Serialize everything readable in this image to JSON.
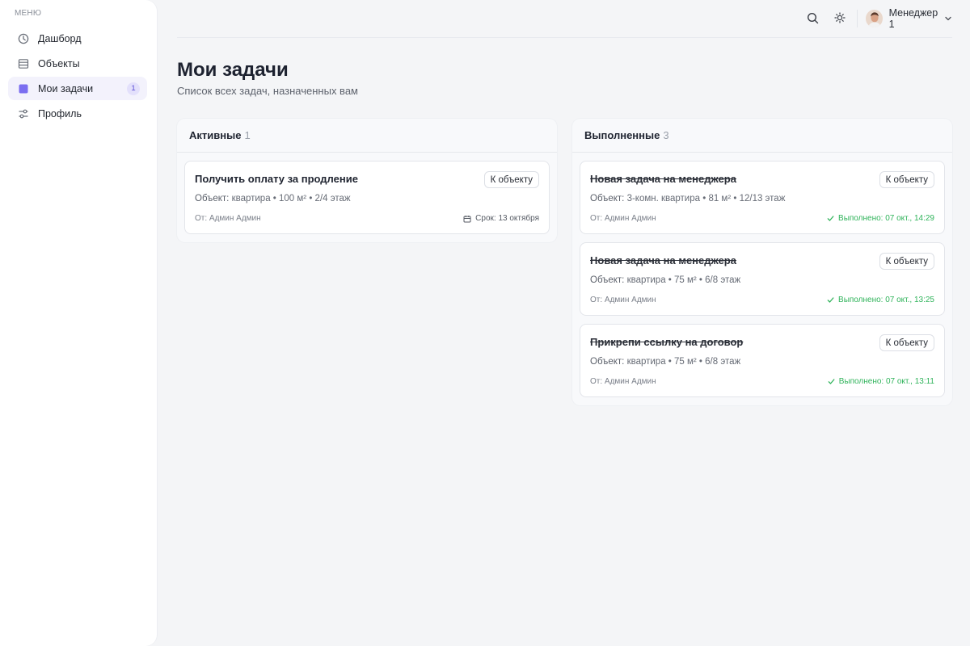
{
  "sidebar": {
    "caption": "МЕНЮ",
    "items": [
      {
        "label": "Дашборд",
        "icon": "dashboard-icon",
        "active": false
      },
      {
        "label": "Объекты",
        "icon": "list-icon",
        "active": false
      },
      {
        "label": "Мои задачи",
        "icon": "tasks-square-icon",
        "active": true,
        "badge": "1"
      },
      {
        "label": "Профиль",
        "icon": "sliders-icon",
        "active": false
      }
    ]
  },
  "topbar": {
    "user_name": "Менеджер 1"
  },
  "page": {
    "title": "Мои задачи",
    "subtitle": "Список всех задач, назначенных вам"
  },
  "columns": {
    "active": {
      "title": "Активные",
      "count": "1",
      "cards": [
        {
          "title": "Получить оплату за продление",
          "button": "К объекту",
          "meta_label": "Объект:",
          "meta_value": "квартира • 100 м² • 2/4 этаж",
          "from": "От: Админ Админ",
          "deadline": "Срок: 13 октября"
        }
      ]
    },
    "done": {
      "title": "Выполненные",
      "count": "3",
      "cards": [
        {
          "title": "Новая задача на менеджера",
          "button": "К объекту",
          "meta_label": "Объект:",
          "meta_value": "3-комн. квартира • 81 м² • 12/13 этаж",
          "from": "От: Админ Админ",
          "status": "Выполнено: 07 окт., 14:29"
        },
        {
          "title": "Новая задача на менеджера",
          "button": "К объекту",
          "meta_label": "Объект:",
          "meta_value": "квартира • 75 м² • 6/8 этаж",
          "from": "От: Админ Админ",
          "status": "Выполнено: 07 окт., 13:25"
        },
        {
          "title": "Прикрепи ссылку на договор",
          "button": "К объекту",
          "meta_label": "Объект:",
          "meta_value": "квартира • 75 м² • 6/8 этаж",
          "from": "От: Админ Админ",
          "status": "Выполнено: 07 окт., 13:11"
        }
      ]
    }
  },
  "colors": {
    "accent": "#7b6ef0",
    "success": "#2fb35a",
    "background": "#f4f5f7"
  }
}
